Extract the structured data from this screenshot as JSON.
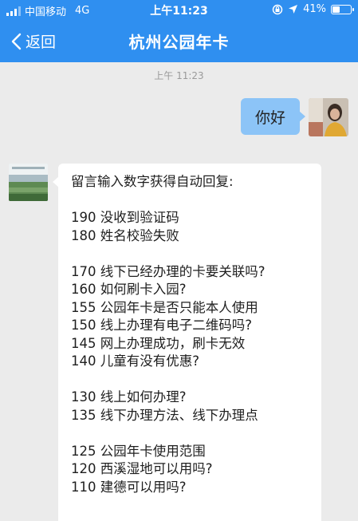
{
  "status_bar": {
    "carrier": "中国移动",
    "network": "4G",
    "time": "上午11:23",
    "battery": "41%",
    "battery_level": 0.41
  },
  "nav": {
    "back_label": "返回",
    "title": "杭州公园年卡"
  },
  "chat": {
    "timestamp": "上午 11:23",
    "user_message": "你好",
    "bot_reply": {
      "intro": "留言输入数字获得自动回复:",
      "group1": [
        "190 没收到验证码",
        "180 姓名校验失败"
      ],
      "group2": [
        "170 线下已经办理的卡要关联吗?",
        "160 如何刷卡入园?",
        "155 公园年卡是否只能本人使用",
        "150 线上办理有电子二维码吗?",
        "145 网上办理成功，刷卡无效",
        "140 儿童有没有优惠?"
      ],
      "group3": [
        "130 线上如何办理?",
        "135 线下办理方法、线下办理点"
      ],
      "group4": [
        "125 公园年卡使用范围",
        "120 西溪湿地可以用吗?",
        "110 建德可以用吗?"
      ]
    }
  },
  "colors": {
    "nav_bg": "#2f8ff0",
    "user_bubble": "#8cc4f7",
    "chat_bg": "#ebebeb"
  }
}
